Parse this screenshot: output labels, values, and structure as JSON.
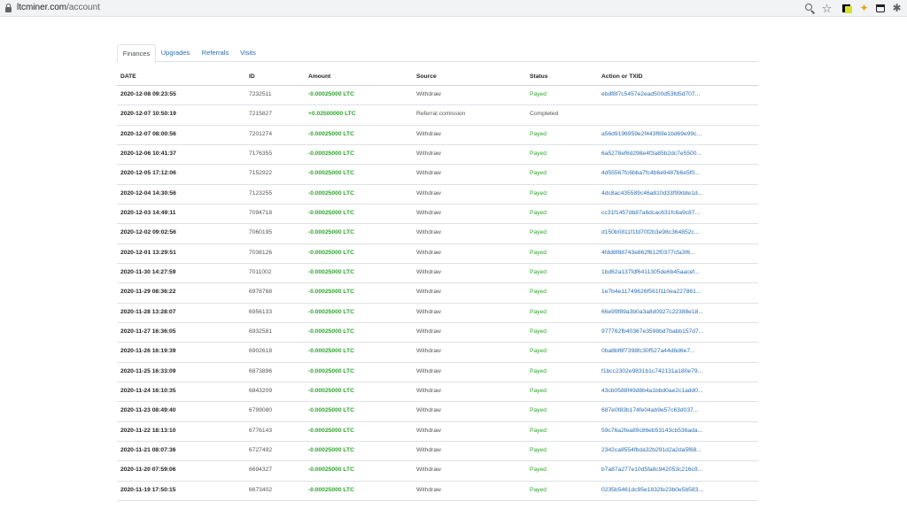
{
  "browser": {
    "url_domain": "ltcminer.com",
    "url_path": "/account",
    "icons": [
      "lock-icon",
      "zoom-icon",
      "star-icon",
      "extension-icon",
      "extension-icon",
      "extension-icon",
      "puzzle-icon"
    ]
  },
  "tabs": [
    {
      "label": "Finances",
      "active": true
    },
    {
      "label": "Upgrades",
      "active": false
    },
    {
      "label": "Referrals",
      "active": false
    },
    {
      "label": "Visits",
      "active": false
    }
  ],
  "table": {
    "headers": {
      "date": "DATE",
      "id": "ID",
      "amount": "Amount",
      "source": "Source",
      "status": "Status",
      "txid": "Action or TXID"
    },
    "rows": [
      {
        "date": "2020-12-08 09:23:55",
        "id": "7232511",
        "amount": "-0.00025000 LTC",
        "source": "Withdraw",
        "status": "Payed",
        "txid": "ebdf8f7c5457e2ead500d53fd5d707..."
      },
      {
        "date": "2020-12-07 10:50:19",
        "id": "7215827",
        "amount": "+0.02500000 LTC",
        "source": "Referral comission",
        "status": "Completed",
        "txid": ""
      },
      {
        "date": "2020-12-07 08:00:56",
        "id": "7201274",
        "amount": "-0.00025000 LTC",
        "source": "Withdraw",
        "status": "Payed",
        "txid": "a56d9196959e2f443f69e1bd69e99c..."
      },
      {
        "date": "2020-12-06 10:41:37",
        "id": "7176355",
        "amount": "-0.00025000 LTC",
        "source": "Withdraw",
        "status": "Payed",
        "txid": "6a5278ef6d298e4f3a85b2dc7e5500..."
      },
      {
        "date": "2020-12-05 17:12:06",
        "id": "7152922",
        "amount": "-0.00025000 LTC",
        "source": "Withdraw",
        "status": "Payed",
        "txid": "4d55567fc6bba7fc4b6e9487b6e5f0..."
      },
      {
        "date": "2020-12-04 14:30:56",
        "id": "7123255",
        "amount": "-0.00025000 LTC",
        "source": "Withdraw",
        "status": "Payed",
        "txid": "4dc8ac435589c46a810d33f99dde1d..."
      },
      {
        "date": "2020-12-03 14:49:11",
        "id": "7094718",
        "amount": "-0.00025000 LTC",
        "source": "Withdraw",
        "status": "Payed",
        "txid": "cc31f1457db87a6dcac631fc6a9c87..."
      },
      {
        "date": "2020-12-02 09:02:56",
        "id": "7060195",
        "amount": "-0.00025000 LTC",
        "source": "Withdraw",
        "status": "Payed",
        "txid": "d150b0811f1fd70f2b3e98c364852c..."
      },
      {
        "date": "2020-12-01 13:29:51",
        "id": "7038126",
        "amount": "-0.00025000 LTC",
        "source": "Withdraw",
        "status": "Payed",
        "txid": "4fdd8f88743e862f612f0377cfa3f6..."
      },
      {
        "date": "2020-11-30 14:27:59",
        "id": "7011002",
        "amount": "-0.00025000 LTC",
        "source": "Withdraw",
        "status": "Payed",
        "txid": "1bd62a137fdf6411305de6b45aacef..."
      },
      {
        "date": "2020-11-29 08:36:22",
        "id": "6978768",
        "amount": "-0.00025000 LTC",
        "source": "Withdraw",
        "status": "Payed",
        "txid": "1e7b4e11749626f561f110ea227861..."
      },
      {
        "date": "2020-11-28 13:28:07",
        "id": "6956133",
        "amount": "-0.00025000 LTC",
        "source": "Withdraw",
        "status": "Payed",
        "txid": "66e99f89a3b0a3a8d0927c22388e18..."
      },
      {
        "date": "2020-11-27 16:36:05",
        "id": "6932581",
        "amount": "-0.00025000 LTC",
        "source": "Withdraw",
        "status": "Payed",
        "txid": "977762fb40367e3598bd7babb157d7..."
      },
      {
        "date": "2020-11-26 16:19:39",
        "id": "6902618",
        "amount": "-0.00025000 LTC",
        "source": "Withdraw",
        "status": "Payed",
        "txid": "0ba8bf6f7398fc30f527a44d6d6e7..."
      },
      {
        "date": "2020-11-25 16:33:09",
        "id": "6873896",
        "amount": "-0.00025000 LTC",
        "source": "Withdraw",
        "status": "Payed",
        "txid": "f1bcc2302e9831b1c742131a180e79..."
      },
      {
        "date": "2020-11-24 16:10:35",
        "id": "6843209",
        "amount": "-0.00025000 LTC",
        "source": "Withdraw",
        "status": "Payed",
        "txid": "43cb0588f49d8b4a1bbd0ae2c1add0..."
      },
      {
        "date": "2020-11-23 08:49:40",
        "id": "6799080",
        "amount": "-0.00025000 LTC",
        "source": "Withdraw",
        "status": "Payed",
        "txid": "687e0f83b174fe04ab9e57c63d037..."
      },
      {
        "date": "2020-11-22 18:13:10",
        "id": "6776143",
        "amount": "-0.00025000 LTC",
        "source": "Withdraw",
        "status": "Payed",
        "txid": "59c76a2fea89c86eb53143cb536ada..."
      },
      {
        "date": "2020-11-21 08:07:36",
        "id": "6727492",
        "amount": "-0.00025000 LTC",
        "source": "Withdraw",
        "status": "Payed",
        "txid": "2342ca8554fbda32b291d2a2da5f68..."
      },
      {
        "date": "2020-11-20 07:59:06",
        "id": "6694327",
        "amount": "-0.00025000 LTC",
        "source": "Withdraw",
        "status": "Payed",
        "txid": "b7a87a277e10d5fa8c942053c216c9..."
      },
      {
        "date": "2020-11-19 17:50:15",
        "id": "6673402",
        "amount": "-0.00025000 LTC",
        "source": "Withdraw",
        "status": "Payed",
        "txid": "0235b5461dc95e1832fe23b0e5b583..."
      }
    ]
  },
  "colors": {
    "link": "#2a6db0",
    "positive": "#2ea52e",
    "text": "#222222",
    "muted": "#555555"
  }
}
